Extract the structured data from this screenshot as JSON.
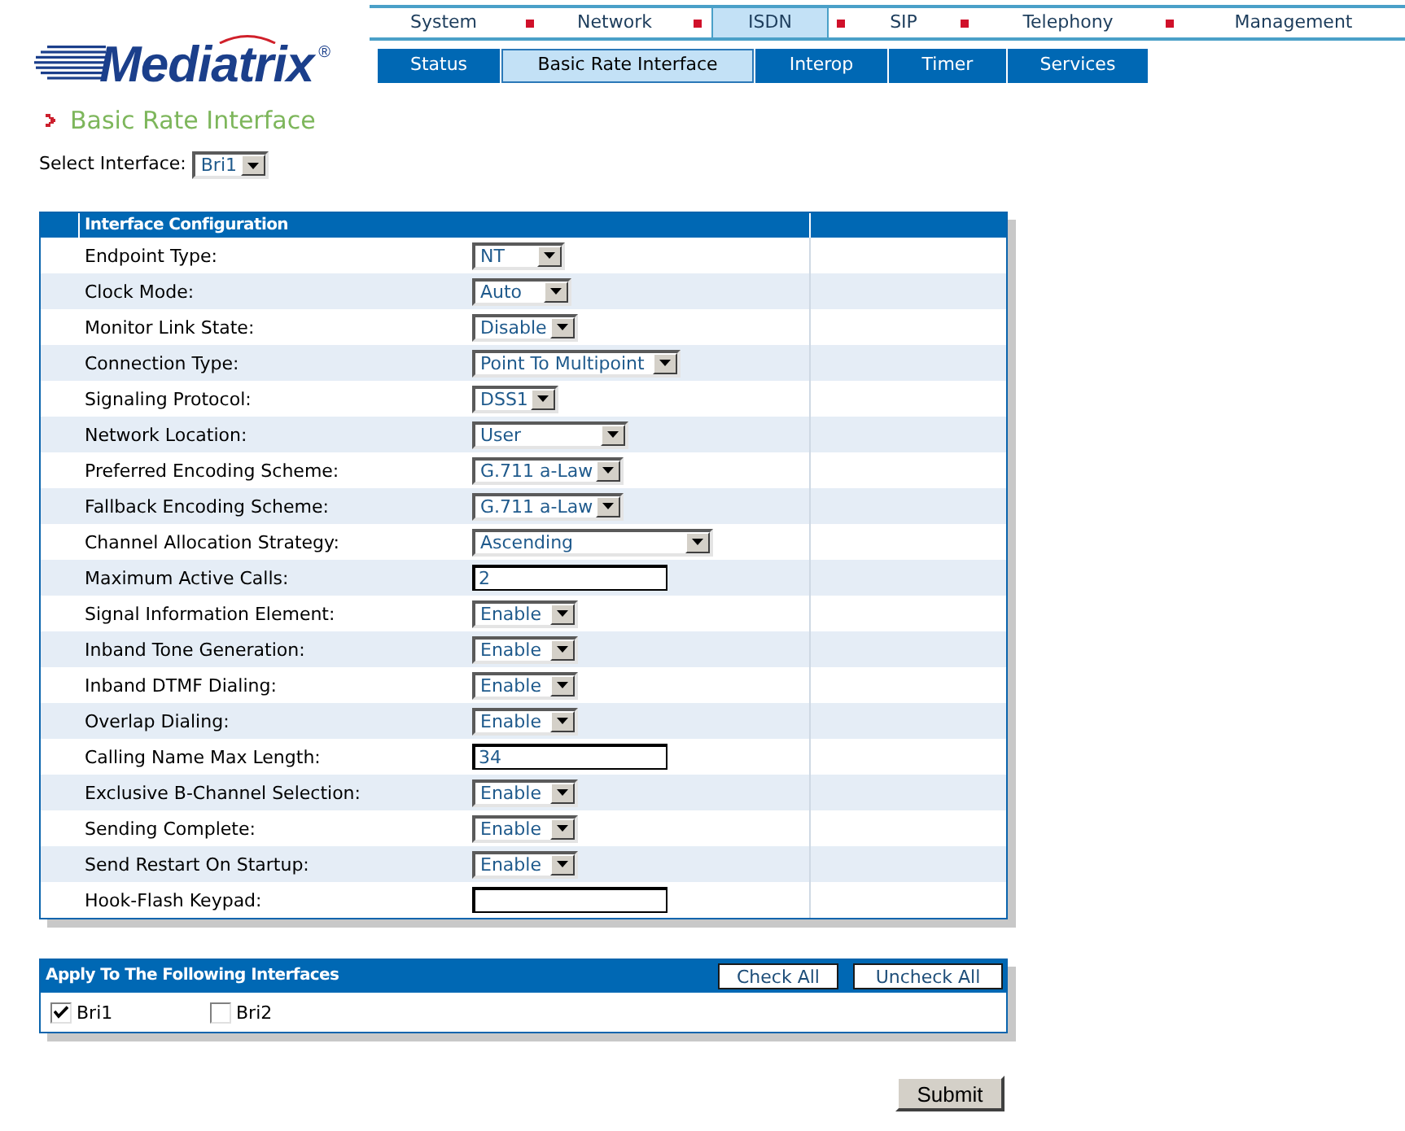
{
  "logo": {
    "wordmark": "Mediatrix",
    "registered": "®"
  },
  "main_nav": [
    {
      "label": "System",
      "selected": false
    },
    {
      "label": "Network",
      "selected": false
    },
    {
      "label": "ISDN",
      "selected": true
    },
    {
      "label": "SIP",
      "selected": false
    },
    {
      "label": "Telephony",
      "selected": false
    },
    {
      "label": "Management",
      "selected": false
    }
  ],
  "sub_nav": [
    {
      "label": "Status",
      "selected": false
    },
    {
      "label": "Basic Rate Interface",
      "selected": true
    },
    {
      "label": "Interop",
      "selected": false
    },
    {
      "label": "Timer",
      "selected": false
    },
    {
      "label": "Services",
      "selected": false
    }
  ],
  "page_title": "Basic Rate Interface",
  "select_interface": {
    "label": "Select Interface:",
    "value": "Bri1"
  },
  "interface_configuration": {
    "title": "Interface Configuration",
    "rows": [
      {
        "label": "Endpoint Type:",
        "kind": "select",
        "value": "NT"
      },
      {
        "label": "Clock Mode:",
        "kind": "select",
        "value": "Auto"
      },
      {
        "label": "Monitor Link State:",
        "kind": "select",
        "value": "Disable"
      },
      {
        "label": "Connection Type:",
        "kind": "select",
        "value": "Point To Multipoint"
      },
      {
        "label": "Signaling Protocol:",
        "kind": "select",
        "value": "DSS1"
      },
      {
        "label": "Network Location:",
        "kind": "select",
        "value": "User"
      },
      {
        "label": "Preferred Encoding Scheme:",
        "kind": "select",
        "value": "G.711 a-Law"
      },
      {
        "label": "Fallback Encoding Scheme:",
        "kind": "select",
        "value": "G.711 a-Law"
      },
      {
        "label": "Channel Allocation Strategy:",
        "kind": "select",
        "value": "Ascending"
      },
      {
        "label": "Maximum Active Calls:",
        "kind": "text",
        "value": "2"
      },
      {
        "label": "Signal Information Element:",
        "kind": "select",
        "value": "Enable"
      },
      {
        "label": "Inband Tone Generation:",
        "kind": "select",
        "value": "Enable"
      },
      {
        "label": "Inband DTMF Dialing:",
        "kind": "select",
        "value": "Enable"
      },
      {
        "label": "Overlap Dialing:",
        "kind": "select",
        "value": "Enable"
      },
      {
        "label": "Calling Name Max Length:",
        "kind": "text",
        "value": "34"
      },
      {
        "label": "Exclusive B-Channel Selection:",
        "kind": "select",
        "value": "Enable"
      },
      {
        "label": "Sending Complete:",
        "kind": "select",
        "value": "Enable"
      },
      {
        "label": "Send Restart On Startup:",
        "kind": "select",
        "value": "Enable"
      },
      {
        "label": "Hook-Flash Keypad:",
        "kind": "text"
      }
    ]
  },
  "apply_panel": {
    "title": "Apply To The Following Interfaces",
    "buttons": [
      "Check All",
      "Uncheck All"
    ],
    "interfaces": [
      {
        "label": "Bri1",
        "checked": true
      },
      {
        "label": "Bri2",
        "checked": false
      }
    ]
  },
  "submit_button": "Submit"
}
